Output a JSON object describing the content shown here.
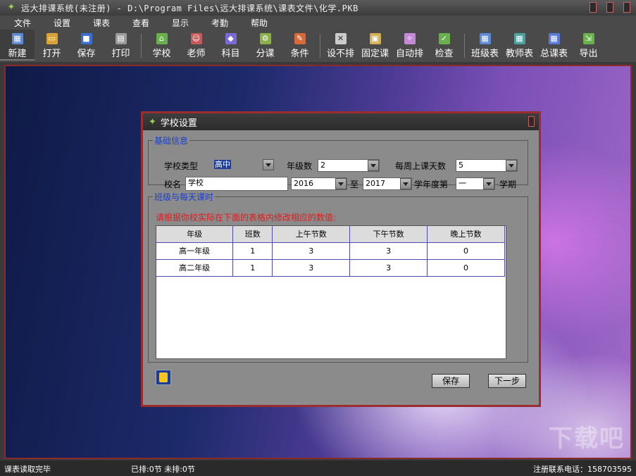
{
  "window": {
    "title": "远大排课系统(未注册) - D:\\Program Files\\远大排课系统\\课表文件\\化学.PKB"
  },
  "menu": [
    "文件",
    "设置",
    "课表",
    "查看",
    "显示",
    "考勤",
    "帮助"
  ],
  "toolbar": [
    {
      "label": "新建",
      "icon": "new-doc-icon",
      "color": "#5a8ad8"
    },
    {
      "label": "打开",
      "icon": "open-folder-icon",
      "color": "#d9a436"
    },
    {
      "label": "保存",
      "icon": "save-disk-icon",
      "color": "#3a6fd0"
    },
    {
      "label": "打印",
      "icon": "printer-icon",
      "color": "#9a9a9a"
    },
    {
      "label": "学校",
      "icon": "school-icon",
      "color": "#6ab04c"
    },
    {
      "label": "老师",
      "icon": "teacher-icon",
      "color": "#c45a5a"
    },
    {
      "label": "科目",
      "icon": "subject-book-icon",
      "color": "#7a6ad8"
    },
    {
      "label": "分课",
      "icon": "assign-lesson-icon",
      "color": "#8ab04c"
    },
    {
      "label": "条件",
      "icon": "condition-icon",
      "color": "#d86a3a"
    },
    {
      "label": "设不排",
      "icon": "exclude-icon",
      "color": "#cccccc"
    },
    {
      "label": "固定课",
      "icon": "fixed-lesson-icon",
      "color": "#d0b050"
    },
    {
      "label": "自动排",
      "icon": "auto-schedule-icon",
      "color": "#c48ad8"
    },
    {
      "label": "检查",
      "icon": "check-icon",
      "color": "#6ab04c"
    },
    {
      "label": "班级表",
      "icon": "class-table-icon",
      "color": "#5a8ad8"
    },
    {
      "label": "教师表",
      "icon": "teacher-table-icon",
      "color": "#4ca0a0"
    },
    {
      "label": "总课表",
      "icon": "master-table-icon",
      "color": "#5a7ad8"
    },
    {
      "label": "导出",
      "icon": "export-icon",
      "color": "#6ab04c"
    }
  ],
  "dialog": {
    "title": "学校设置",
    "basic": {
      "legend": "基础信息",
      "school_type_label": "学校类型",
      "school_type": "高中",
      "grades_label": "年级数",
      "grades": "2",
      "days_label": "每周上课天数",
      "days": "5",
      "school_name_label": "校名",
      "school_name": "学校",
      "year_from": "2016",
      "to_label": "至",
      "year_to": "2017",
      "semester_label": "学年度第",
      "semester": "一",
      "semester_suffix": "学期"
    },
    "classes": {
      "legend": "班级与每天课时",
      "hint": "请根据你校实际在下面的表格内修改相应的数值:",
      "columns": [
        "年级",
        "班数",
        "上午节数",
        "下午节数",
        "晚上节数"
      ],
      "rows": [
        [
          "高一年级",
          "1",
          "3",
          "3",
          "0"
        ],
        [
          "高二年级",
          "1",
          "3",
          "3",
          "0"
        ]
      ]
    },
    "save_button": "保存",
    "next_button": "下一步"
  },
  "status": {
    "left": "课表读取完毕",
    "middle": "已排:0节 未排:0节",
    "right": "注册联系电话：158703595"
  },
  "watermark": "下载吧"
}
